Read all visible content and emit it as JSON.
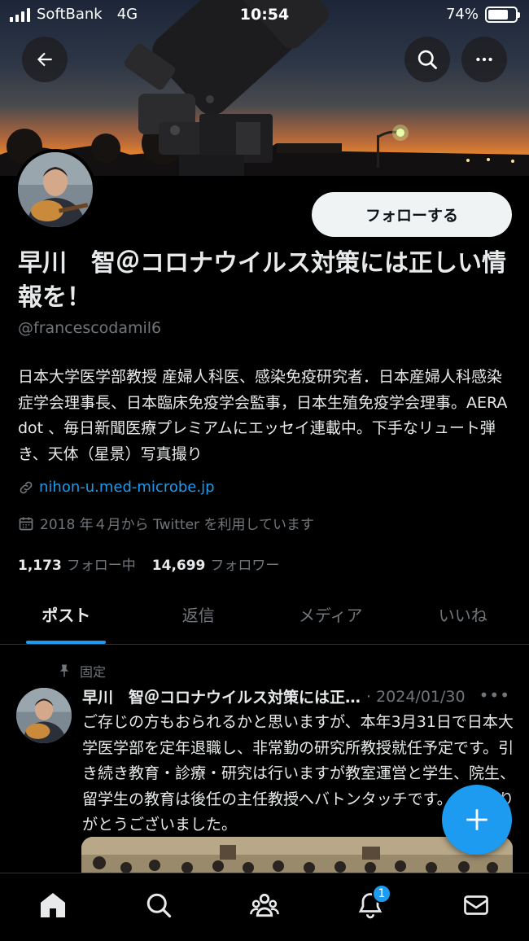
{
  "status_bar": {
    "carrier": "SoftBank",
    "network": "4G",
    "time": "10:54",
    "battery": "74%",
    "battery_level": 0.74
  },
  "profile": {
    "follow_label": "フォローする",
    "display_name": "早川　智＠コロナウイルス対策には正しい情報を！",
    "handle": "@francescodamil6",
    "bio": "日本大学医学部教授 産婦人科医、感染免疫研究者．日本産婦人科感染症学会理事長、日本臨床免疫学会監事，日本生殖免疫学会理事。AERA dot 、毎日新聞医療プレミアムにエッセイ連載中。下手なリュート弾き、天体（星景）写真撮り",
    "link": "nihon-u.med-microbe.jp",
    "joined": "2018 年４月から Twitter を利用しています",
    "following_count": "1,173",
    "following_label": "フォロー中",
    "followers_count": "14,699",
    "followers_label": "フォロワー"
  },
  "tabs": [
    {
      "label": "ポスト",
      "active": true
    },
    {
      "label": "返信",
      "active": false
    },
    {
      "label": "メディア",
      "active": false
    },
    {
      "label": "いいね",
      "active": false
    }
  ],
  "pinned_tweet": {
    "pinned_label": "固定",
    "name": "早川　智＠コロナウイルス対策には正しい情報を！",
    "date": "· 2024/01/30",
    "more": "•••",
    "body": "ご存じの方もおられるかと思いますが、本年3月31日で日本大学医学部を定年退職し、非常勤の研究所教授就任予定です。引き続き教育・診療・研究は行いますが教室運営と学生、院生、留学生の教育は後任の主任教授へバトンタッチです。長年ありがとうございました。"
  },
  "bottom_nav": {
    "notification_badge": "1"
  },
  "icons": {
    "back": "arrow-left-icon",
    "search": "search-icon",
    "more": "more-icon",
    "link": "link-icon",
    "calendar": "calendar-icon",
    "pin": "pin-icon",
    "compose": "plus-icon",
    "home": "home-icon",
    "explore": "search-icon",
    "communities": "people-icon",
    "notifications": "bell-icon",
    "messages": "mail-icon"
  },
  "colors": {
    "accent": "#1d9bf0",
    "background": "#000000",
    "muted": "#71767b"
  }
}
